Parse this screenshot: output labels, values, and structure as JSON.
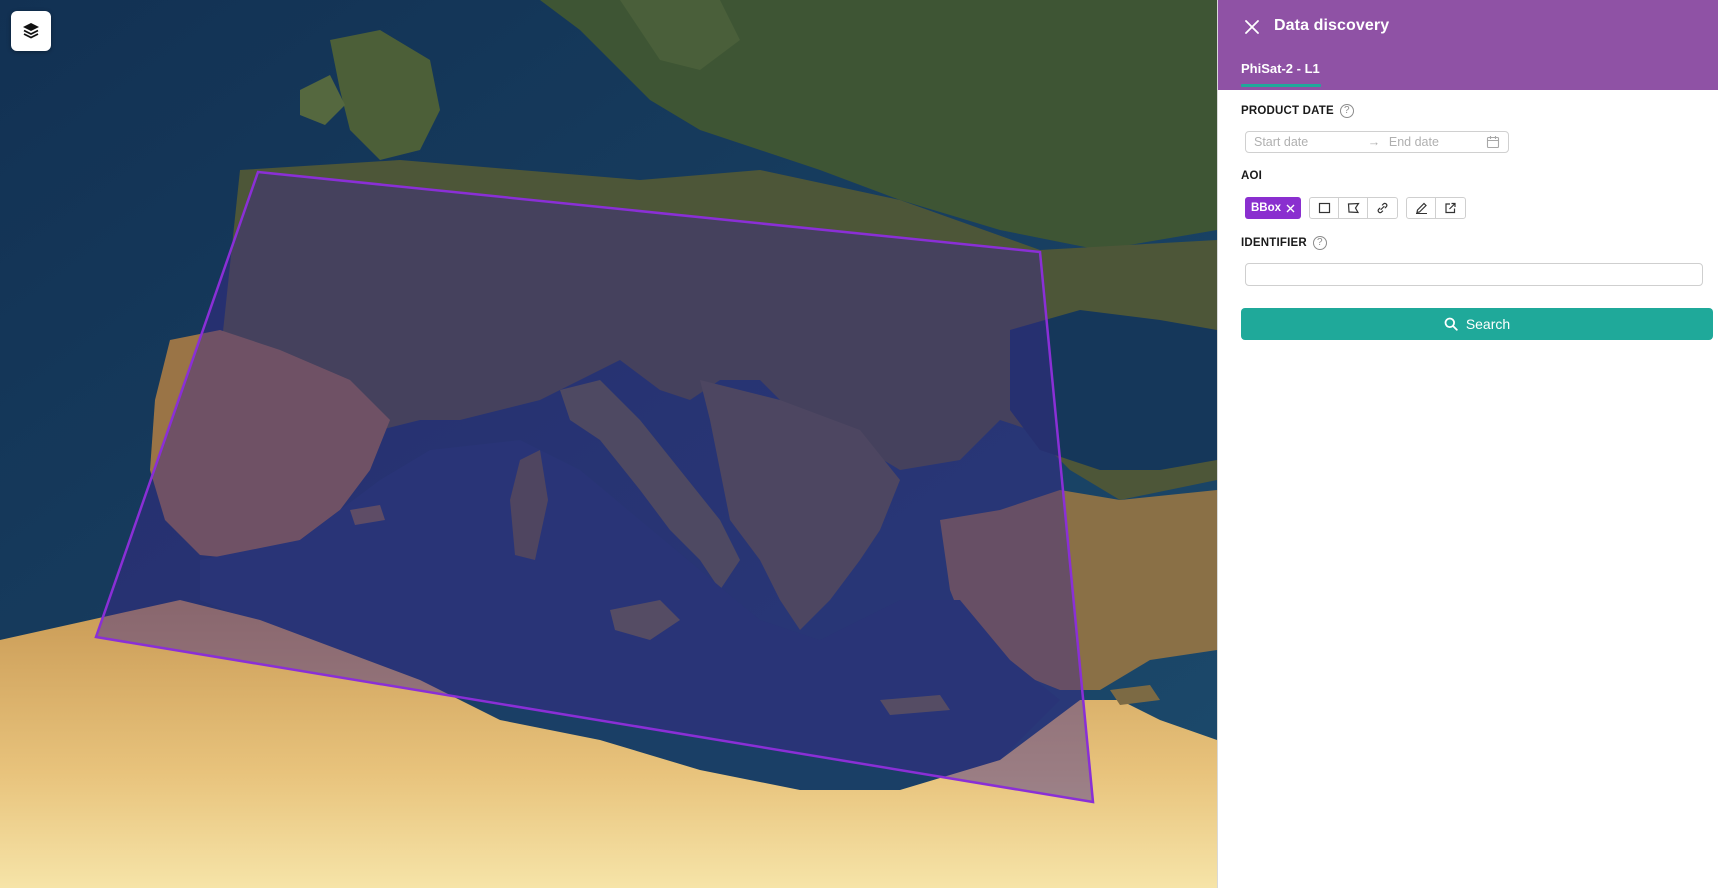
{
  "map": {
    "layers_button_icon": "layers-icon",
    "aoi_outline_color": "#8a2fd6"
  },
  "panel": {
    "title": "Data discovery",
    "close_icon": "close-icon",
    "header_color": "#8f52a5",
    "tab_label": "PhiSat-2 - L1",
    "product_date": {
      "label": "PRODUCT DATE",
      "start_placeholder": "Start date",
      "end_placeholder": "End date"
    },
    "aoi": {
      "label": "AOI",
      "tag": "BBox",
      "tools": [
        "rectangle-icon",
        "polygon-icon",
        "link-icon",
        "pencil-icon",
        "import-icon"
      ]
    },
    "identifier": {
      "label": "IDENTIFIER",
      "value": ""
    },
    "search_label": "Search",
    "accent_color": "#1fa99a"
  }
}
